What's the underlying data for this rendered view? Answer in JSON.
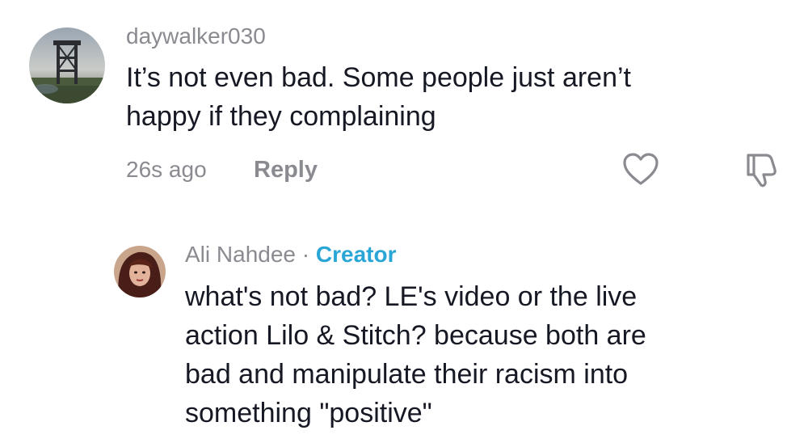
{
  "comment_1": {
    "username": "daywalker030",
    "text_line_1": "It’s not even bad. Some people just aren’t",
    "text_line_2": "happy if they complaining",
    "timestamp": "26s ago",
    "reply_label": "Reply",
    "like_icon": "heart-outline-icon",
    "dislike_icon": "thumbs-down-outline-icon"
  },
  "reply_1": {
    "username": "Ali Nahdee",
    "separator": "·",
    "badge": "Creator",
    "text_lines": [
      "what's not bad? LE's video or the live",
      "action Lilo & Stitch? because both are",
      "bad and manipulate their racism into",
      "something \"positive\""
    ]
  },
  "colors": {
    "creator_badge": "#2aa6d6",
    "secondary_text": "#8a8b91",
    "primary_text": "#161823"
  }
}
